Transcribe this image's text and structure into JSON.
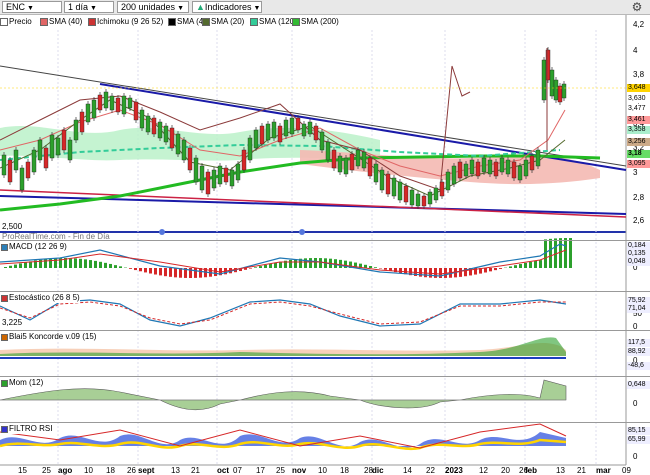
{
  "toolbar": {
    "symbol": "ENC",
    "interval": "1 día",
    "units": "200 unidades",
    "indicators": "Indicadores"
  },
  "legend": [
    {
      "label": "Precio",
      "color": "#ffffff"
    },
    {
      "label": "SMA (40)",
      "color": "#e06666"
    },
    {
      "label": "Ichimoku (9 26 52)",
      "color": "#cc3333"
    },
    {
      "label": "SMA (4)",
      "color": "#000000"
    },
    {
      "label": "SMA (20)",
      "color": "#556b2f"
    },
    {
      "label": "SMA (120)",
      "color": "#33cc99"
    },
    {
      "label": "SMA (200)",
      "color": "#33bb33"
    }
  ],
  "price_axis": [
    "4,2",
    "4",
    "3,8",
    "3,6",
    "3,4",
    "3,2",
    "3",
    "2,8",
    "2,6"
  ],
  "price_values": [
    {
      "text": "3,648",
      "bg": "#ffd400"
    },
    {
      "text": "3,630",
      "bg": "#ffffff"
    },
    {
      "text": "3,477",
      "bg": "#ffffff"
    },
    {
      "text": "3,461",
      "bg": "#ff9999"
    },
    {
      "text": "3,358",
      "bg": "#aaeecc"
    },
    {
      "text": "3,256",
      "bg": "#ccaa88"
    },
    {
      "text": "3,18",
      "bg": "#66dd66"
    },
    {
      "text": "3,095",
      "bg": "#ff9999"
    }
  ],
  "misc": {
    "price_low_label": "2,500",
    "footer": "ProRealTime.com - Fin de Día",
    "stoch_low": "3,225"
  },
  "panels": [
    {
      "label": "MACD (12 26 9)",
      "color": "#2c7fb8",
      "axis": [
        "0,1",
        "0"
      ],
      "values": [
        "0,184",
        "0,135",
        "0,048"
      ]
    },
    {
      "label": "Estocástico (26 8 5)",
      "color": "#cc3333",
      "axis": [
        "100",
        "50",
        "0"
      ],
      "values": [
        "75,92",
        "71,04"
      ]
    },
    {
      "label": "Blai5 Koncorde v.09 (15)",
      "color": "#cc6600",
      "axis": [
        "0"
      ],
      "values": [
        "117,5",
        "88,92",
        "-48,6"
      ]
    },
    {
      "label": "Mom (12)",
      "color": "#2ca02c",
      "axis": [
        "0,5",
        "0"
      ],
      "values": [
        "0,648"
      ]
    },
    {
      "label": "FILTRO RSI",
      "color": "#3333cc",
      "axis": [
        "100",
        "0"
      ],
      "values": [
        "85,15",
        "65,99"
      ]
    }
  ],
  "x_axis": [
    {
      "t": "15",
      "b": false
    },
    {
      "t": "25",
      "b": false
    },
    {
      "t": "ago",
      "b": true
    },
    {
      "t": "10",
      "b": false
    },
    {
      "t": "18",
      "b": false
    },
    {
      "t": "26",
      "b": false
    },
    {
      "t": "sept",
      "b": true
    },
    {
      "t": "13",
      "b": false
    },
    {
      "t": "21",
      "b": false
    },
    {
      "t": "oct",
      "b": true
    },
    {
      "t": "07",
      "b": false
    },
    {
      "t": "17",
      "b": false
    },
    {
      "t": "25",
      "b": false
    },
    {
      "t": "nov",
      "b": true
    },
    {
      "t": "10",
      "b": false
    },
    {
      "t": "18",
      "b": false
    },
    {
      "t": "28",
      "b": false
    },
    {
      "t": "dic",
      "b": true
    },
    {
      "t": "14",
      "b": false
    },
    {
      "t": "22",
      "b": false
    },
    {
      "t": "2023",
      "b": true
    },
    {
      "t": "12",
      "b": false
    },
    {
      "t": "20",
      "b": false
    },
    {
      "t": "26",
      "b": false
    },
    {
      "t": "feb",
      "b": true
    },
    {
      "t": "13",
      "b": false
    },
    {
      "t": "21",
      "b": false
    },
    {
      "t": "mar",
      "b": true
    },
    {
      "t": "09",
      "b": false
    }
  ]
}
